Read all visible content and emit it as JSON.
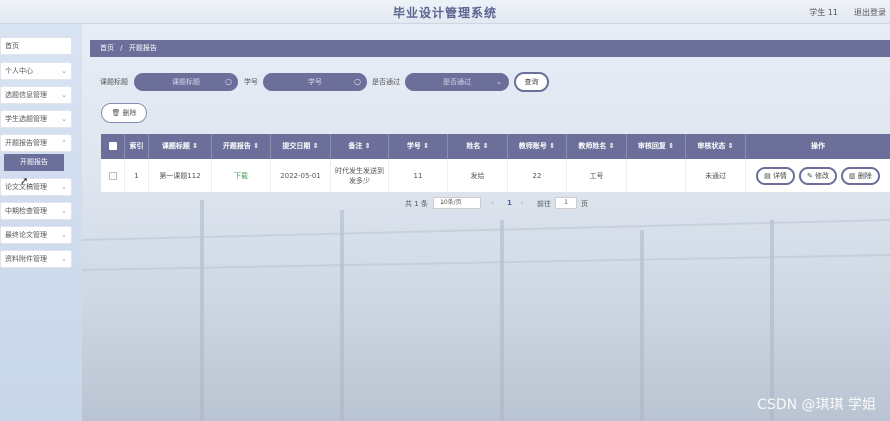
{
  "app": {
    "title": "毕业设计管理系统",
    "user": "学生 11",
    "logout": "退出登录"
  },
  "sidebar": {
    "items": [
      {
        "label": "首页"
      },
      {
        "label": "个人中心"
      },
      {
        "label": "选题信息管理"
      },
      {
        "label": "学生选题管理"
      },
      {
        "label": "开题报告管理"
      },
      {
        "label": "论文文稿管理"
      },
      {
        "label": "中期检查管理"
      },
      {
        "label": "最终论文管理"
      },
      {
        "label": "资料附件管理"
      }
    ],
    "active_sub": "开题报告"
  },
  "breadcrumb": {
    "home": "首页",
    "sep": "/",
    "current": "开题报告"
  },
  "search": {
    "title_label": "课题标题",
    "title_placeholder": "课题标题",
    "studentno_label": "学号",
    "studentno_placeholder": "学号",
    "passed_label": "是否通过",
    "passed_placeholder": "是否通过",
    "query_label": "查询"
  },
  "toolbar": {
    "delete_label": "删除"
  },
  "table": {
    "headers": [
      "索引",
      "课题标题 ⇕",
      "开题报告 ⇕",
      "提交日期 ⇕",
      "备注 ⇕",
      "学号 ⇕",
      "姓名 ⇕",
      "教师账号 ⇕",
      "教师姓名 ⇕",
      "审核回复 ⇕",
      "审核状态 ⇕",
      "操作"
    ],
    "rows": [
      {
        "index": "1",
        "title": "第一课题112",
        "report": "下载",
        "date": "2022-05-01",
        "note": "时代发生发送到发多少",
        "student_no": "11",
        "name": "发给",
        "teacher_account": "22",
        "teacher_name": "工号",
        "reply": "",
        "status": "未通过"
      }
    ],
    "actions": {
      "detail": "详情",
      "edit": "修改",
      "delete": "删除"
    }
  },
  "pager": {
    "total": "共 1 条",
    "page_size": "10条/页",
    "current": "1",
    "goto_label": "前往",
    "goto_value": "1",
    "page_unit": "页"
  },
  "watermark": "CSDN @琪琪 学姐",
  "colors": {
    "primary": "#6b6f9a",
    "download": "#3aa155"
  }
}
